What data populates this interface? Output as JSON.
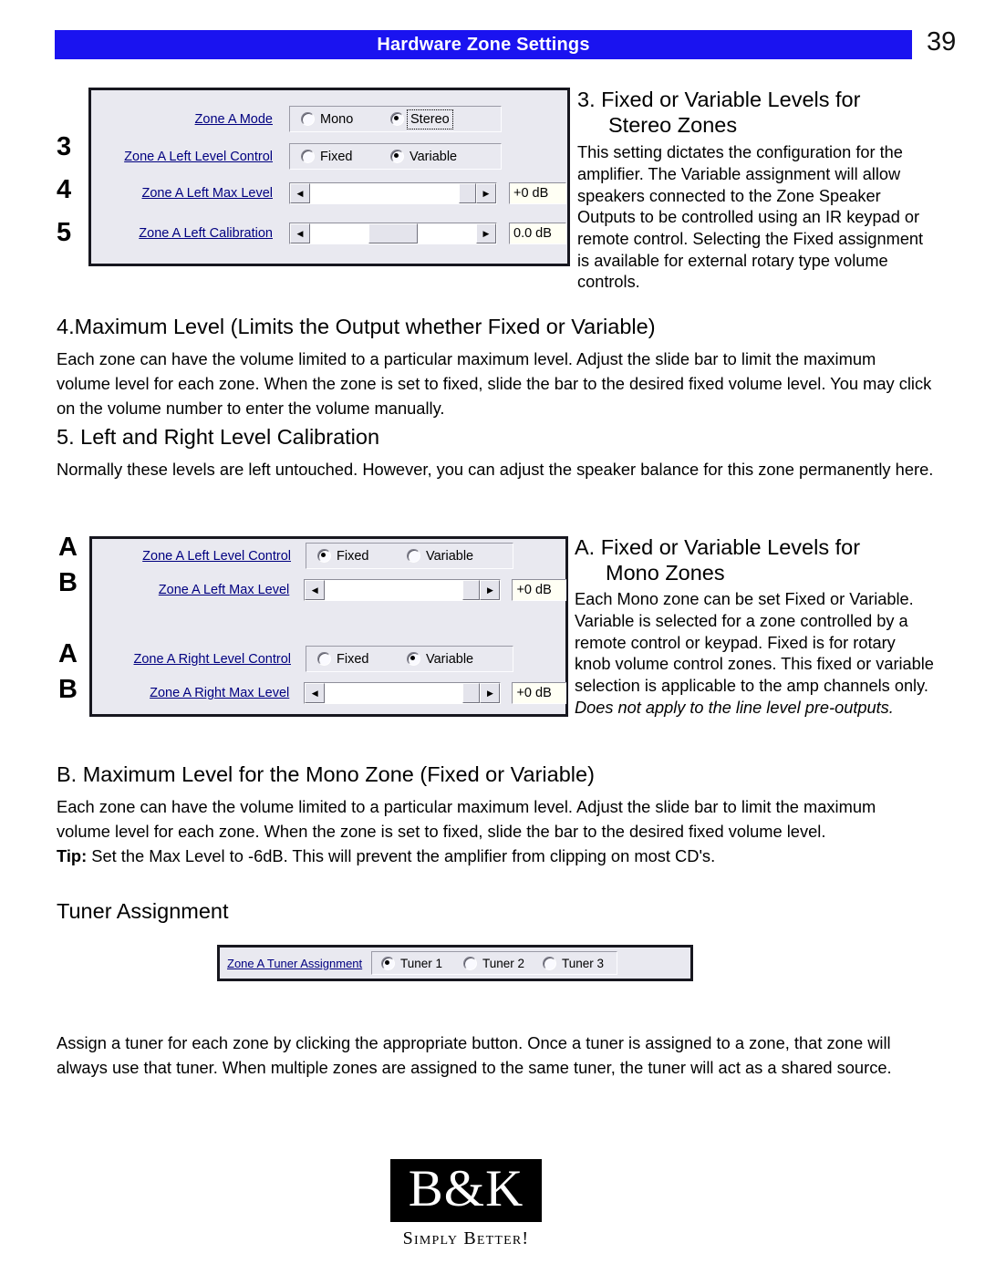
{
  "header": {
    "title": "Hardware Zone Settings",
    "page_number": "39",
    "banner_color": "#1a13f0"
  },
  "markers": {
    "three": "3",
    "four": "4",
    "five": "5",
    "a1": "A",
    "b1": "B",
    "a2": "A",
    "b2": "B"
  },
  "dialog_stereo": {
    "rows": [
      {
        "label": "Zone A Mode",
        "type": "radio",
        "options": [
          {
            "text": "Mono",
            "selected": false,
            "focused": false
          },
          {
            "text": "Stereo",
            "selected": true,
            "focused": true
          }
        ]
      },
      {
        "label": "Zone A Left Level Control",
        "type": "radio",
        "options": [
          {
            "text": "Fixed",
            "selected": false,
            "focused": false
          },
          {
            "text": "Variable",
            "selected": true,
            "focused": false
          }
        ]
      },
      {
        "label": "Zone A Left Max Level",
        "type": "slider",
        "value": "+0 dB",
        "thumb_position": "right"
      },
      {
        "label": "Zone A Left Calibration",
        "type": "slider",
        "value": "0.0 dB",
        "thumb_position": "center"
      }
    ]
  },
  "dialog_mono": {
    "rows": [
      {
        "label": "Zone A Left Level Control",
        "type": "radio",
        "options": [
          {
            "text": "Fixed",
            "selected": true,
            "focused": false
          },
          {
            "text": "Variable",
            "selected": false,
            "focused": false
          }
        ]
      },
      {
        "label": "Zone A Left Max Level",
        "type": "slider",
        "value": "+0 dB",
        "thumb_position": "right"
      },
      {
        "label": "Zone A Right Level Control",
        "type": "radio",
        "options": [
          {
            "text": "Fixed",
            "selected": false,
            "focused": false
          },
          {
            "text": "Variable",
            "selected": true,
            "focused": false
          }
        ]
      },
      {
        "label": "Zone A Right Max Level",
        "type": "slider",
        "value": "+0 dB",
        "thumb_position": "right"
      }
    ]
  },
  "dialog_tuner": {
    "label": "Zone A Tuner Assignment",
    "options": [
      {
        "text": "Tuner 1",
        "selected": true
      },
      {
        "text": "Tuner 2",
        "selected": false
      },
      {
        "text": "Tuner 3",
        "selected": false
      }
    ]
  },
  "section_3": {
    "heading_line1": "3. Fixed or Variable Levels for",
    "heading_line2": "Stereo Zones",
    "body": "This setting dictates the configuration for the amplifier.  The Variable assignment will allow speakers connected to the Zone Speaker Outputs to be controlled using an IR keypad or remote control.  Selecting the Fixed assignment is available for external rotary type volume controls."
  },
  "section_4": {
    "heading": "4.Maximum Level (Limits the Output whether Fixed or Variable)",
    "body": "Each zone can have the volume limited to a particular maximum level.  Adjust the slide bar to limit the maximum volume level for each zone.  When the zone is set to fixed, slide the bar to the desired fixed volume level.  You may click on the volume number to enter the volume manually."
  },
  "section_5": {
    "heading": "5. Left and Right Level Calibration",
    "body": "Normally these levels are left untouched. However, you can adjust the speaker balance for this zone permanently here."
  },
  "section_a": {
    "heading_line1": "A. Fixed or Variable Levels for",
    "heading_line2": "Mono Zones",
    "body": "Each Mono zone can be set Fixed or Variable. Variable is selected for a zone controlled by a remote control or keypad. Fixed is for rotary knob volume control zones. This fixed or variable selection is applicable to the amp channels only. ",
    "body_italic": "Does not apply to the line level pre-outputs."
  },
  "section_b": {
    "heading": "B. Maximum Level for the Mono Zone (Fixed or Variable)",
    "body": "Each zone can have the volume limited to a particular maximum level.  Adjust the slide bar to limit the maximum volume level for each zone.  When the zone is set to fixed, slide the bar to the desired fixed volume level.",
    "tip_label": "Tip:",
    "tip_body": " Set the Max Level to -6dB. This will prevent the amplifier from clipping on most CD's."
  },
  "section_tuner": {
    "heading": "Tuner Assignment",
    "body": "Assign a tuner for each zone by clicking the appropriate button. Once a tuner is assigned to a zone, that zone will always use that tuner.  When multiple zones are assigned to the same tuner, the tuner will act as a shared source."
  },
  "logo": {
    "mark": "B&K",
    "tagline": "Simply Better!"
  }
}
